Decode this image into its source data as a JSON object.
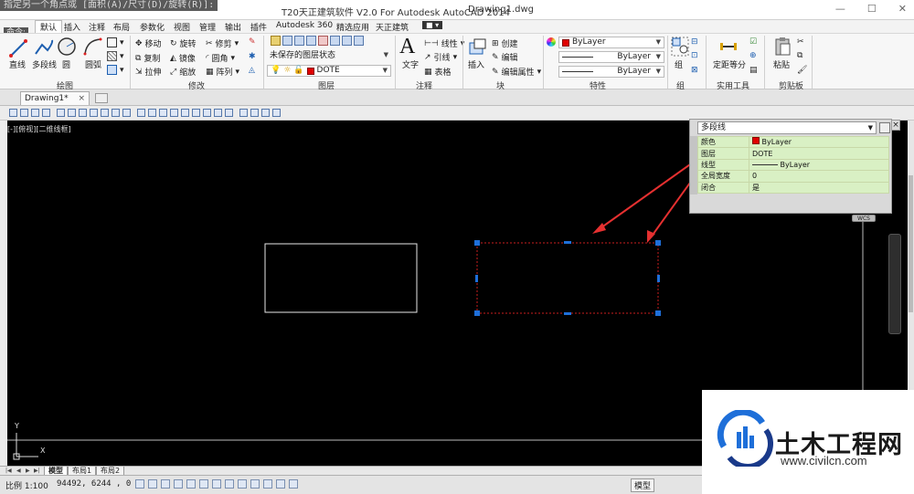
{
  "window": {
    "title": "T20天正建筑软件 V2.0 For Autodesk AutoCAD 2014",
    "filename": "Drawing1.dwg"
  },
  "command": {
    "prompt": "指定另一个角点或 [面积(A)/尺寸(D)/旋转(R)]:",
    "label": "命令:"
  },
  "menu_tabs": [
    "默认",
    "插入",
    "注释",
    "布局",
    "参数化",
    "视图",
    "管理",
    "输出",
    "插件",
    "Autodesk 360",
    "精选应用",
    "天正建筑"
  ],
  "ribbon": {
    "draw": {
      "title": "绘图",
      "line": "直线",
      "polyline": "多段线",
      "circle": "圆",
      "arc": "圆弧"
    },
    "modify": {
      "title": "修改",
      "items": [
        "移动",
        "旋转",
        "修剪",
        "复制",
        "镜像",
        "圆角",
        "拉伸",
        "缩放",
        "阵列"
      ]
    },
    "layer": {
      "title": "图层",
      "state": "未保存的图层状态",
      "current": "DOTE"
    },
    "annotation": {
      "title": "注释",
      "text": "文字",
      "items": [
        "线性",
        "引线",
        "表格"
      ]
    },
    "block": {
      "title": "块",
      "insert": "插入",
      "items": [
        "创建",
        "编辑",
        "编辑属性"
      ]
    },
    "properties": {
      "title": "特性",
      "color": "ByLayer",
      "linetype": "ByLayer",
      "lineweight": "ByLayer"
    },
    "group": {
      "title": "组",
      "label": "组"
    },
    "utilities": {
      "title": "实用工具",
      "measure": "定距等分"
    },
    "clipboard": {
      "title": "剪贴板",
      "paste": "粘贴"
    }
  },
  "doc_tab": {
    "name": "Drawing1*",
    "close": "×"
  },
  "viewport_label": "[-][俯视][二维线框]",
  "properties_palette": {
    "object_type": "多段线",
    "close": "×",
    "rows": [
      {
        "key": "颜色",
        "value": "ByLayer",
        "swatch": "#e00000"
      },
      {
        "key": "图层",
        "value": "DOTE"
      },
      {
        "key": "线型",
        "value": "ByLayer"
      },
      {
        "key": "全局宽度",
        "value": "0"
      },
      {
        "key": "闭合",
        "value": "是"
      }
    ]
  },
  "ucs": {
    "y": "Y",
    "x": "X"
  },
  "layout_tabs": [
    "模型",
    "布局1",
    "布局2"
  ],
  "status": {
    "scale": "比例 1:100",
    "coords": "94492, 6244 , 0",
    "model": "模型"
  },
  "watermark": {
    "brand": "土木工程网",
    "url": "www.civilcn.com"
  },
  "colors": {
    "accent_blue": "#1e6fd9",
    "highlight_red": "#e00000",
    "selection_dash": "#c81e1e",
    "property_green": "#d9f0c4"
  }
}
